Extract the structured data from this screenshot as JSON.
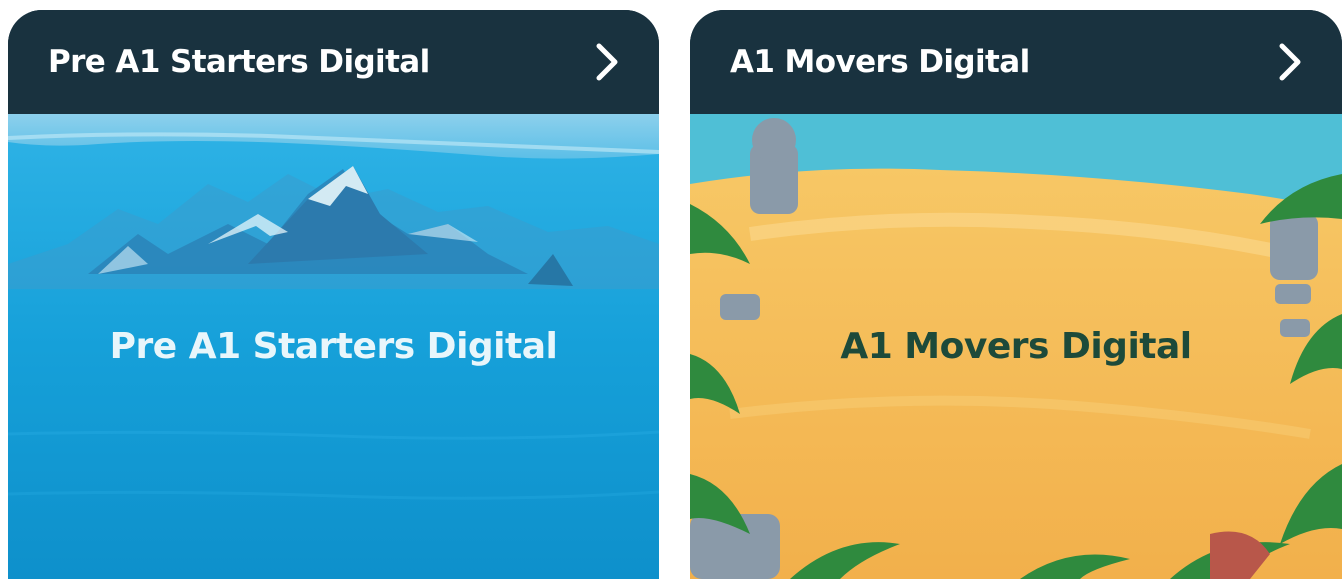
{
  "cards": [
    {
      "title": "Pre A1 Starters Digital",
      "image_text": "Pre A1 Starters Digital",
      "chevron_icon": "chevron-right-icon",
      "image_theme": "ocean-mountains",
      "accent_color": "#1aa0d8"
    },
    {
      "title": "A1 Movers Digital",
      "image_text": "A1 Movers Digital",
      "chevron_icon": "chevron-right-icon",
      "image_theme": "sandy-island",
      "accent_color": "#f4b754"
    }
  ],
  "colors": {
    "header_bg": "#19323f",
    "header_text": "#ffffff"
  }
}
